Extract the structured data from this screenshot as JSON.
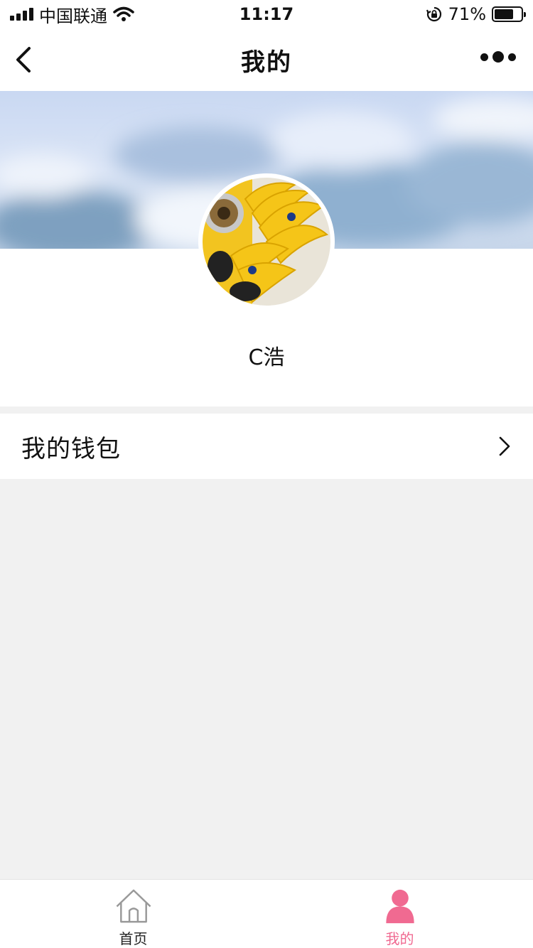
{
  "status_bar": {
    "carrier": "中国联通",
    "time": "11:17",
    "battery_percent": "71%",
    "battery_level": 0.71
  },
  "nav": {
    "title": "我的"
  },
  "profile": {
    "username": "C浩"
  },
  "menu": {
    "items": [
      {
        "label": "我的钱包"
      }
    ]
  },
  "tabbar": {
    "tabs": [
      {
        "label": "首页",
        "icon": "home-icon",
        "active": false
      },
      {
        "label": "我的",
        "icon": "user-icon",
        "active": true
      }
    ],
    "active_color": "#f06a91",
    "inactive_color": "#222222"
  }
}
